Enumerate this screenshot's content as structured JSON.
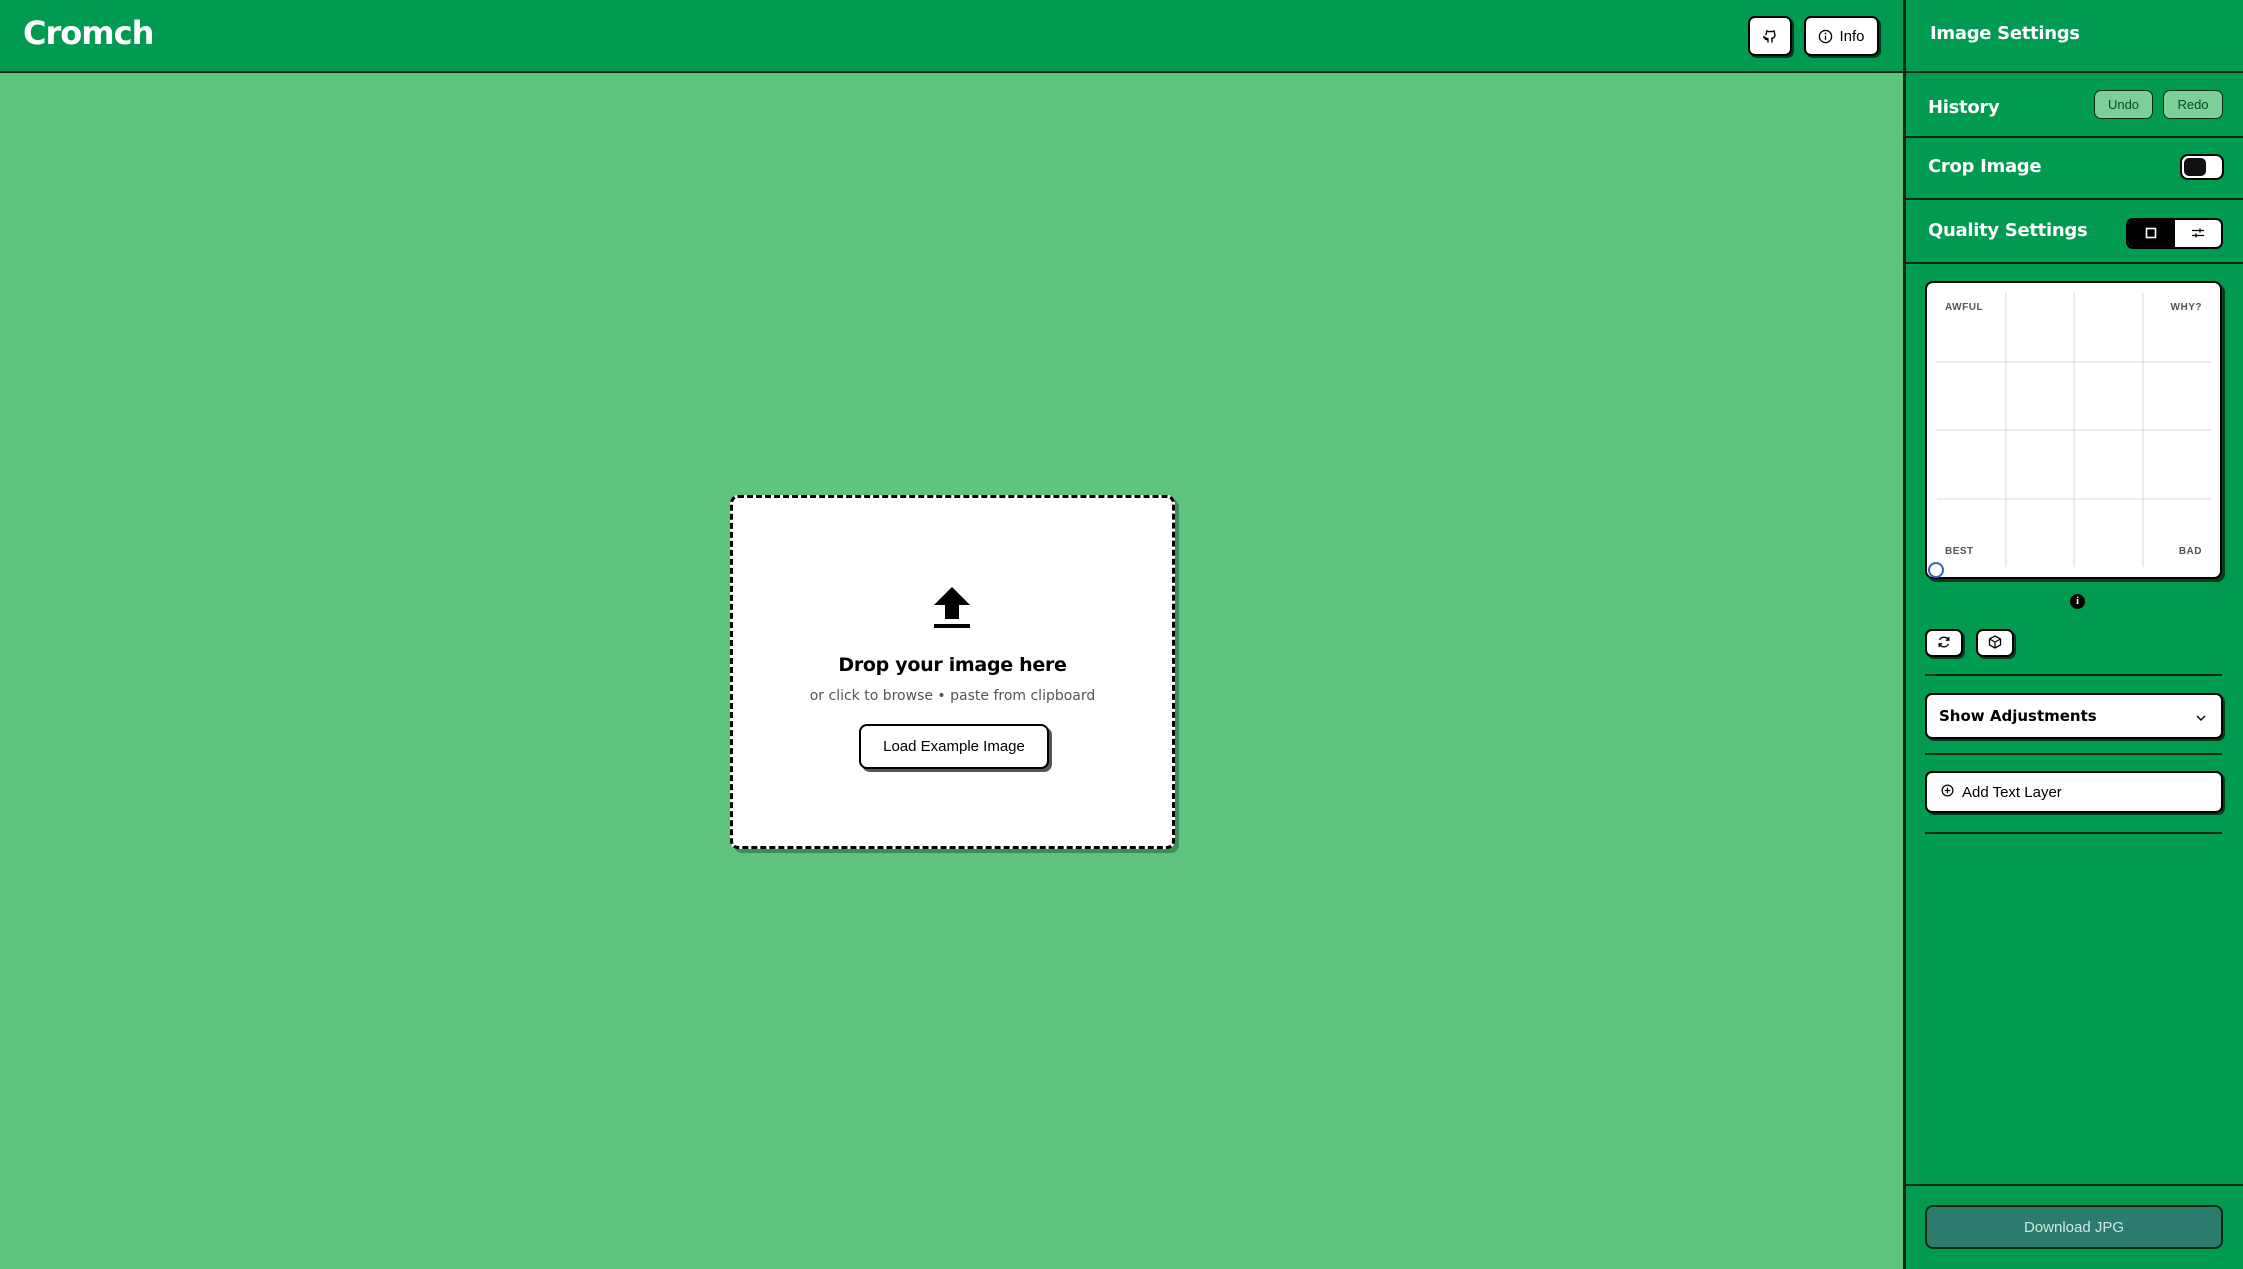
{
  "app": {
    "name": "Cromch"
  },
  "header": {
    "github_icon": "github-icon",
    "info_label": "Info"
  },
  "dropzone": {
    "title": "Drop your image here",
    "subtitle": "or click to browse • paste from clipboard",
    "example_button": "Load Example Image",
    "icon": "upload-icon"
  },
  "sidebar": {
    "title": "Image Settings",
    "history": {
      "label": "History",
      "undo": "Undo",
      "redo": "Redo"
    },
    "crop": {
      "label": "Crop Image",
      "enabled": false
    },
    "quality": {
      "label": "Quality Settings",
      "modes": [
        "square-icon",
        "sliders-icon"
      ],
      "selected_mode": 0,
      "corners": {
        "top_left": "AWFUL",
        "top_right": "WHY?",
        "bottom_left": "BEST",
        "bottom_right": "BAD"
      },
      "info": "i"
    },
    "adjustments_label": "Show Adjustments",
    "add_text_label": "Add Text Layer",
    "download_label": "Download JPG"
  }
}
